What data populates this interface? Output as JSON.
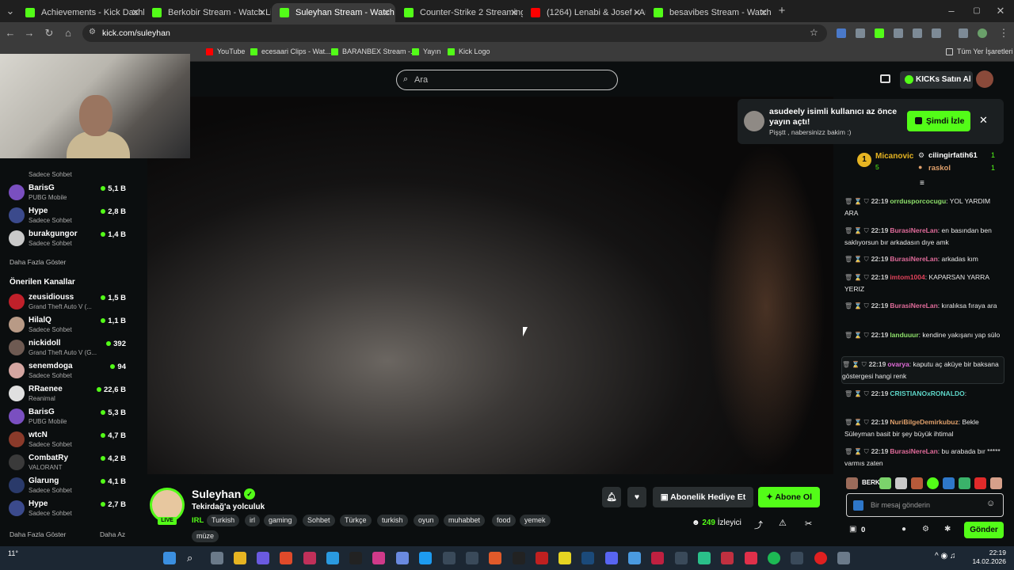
{
  "browser": {
    "tabs": [
      {
        "label": "Achievements - Kick Dashboard",
        "icon": "kick-icon"
      },
      {
        "label": "Berkobir Stream - Watch Live o",
        "icon": "kick-icon"
      },
      {
        "label": "Suleyhan Stream - Watch Li",
        "icon": "kick-icon",
        "active": true
      },
      {
        "label": "Counter-Strike 2 Streaming - Li",
        "icon": "kick-icon"
      },
      {
        "label": "(1264) Lenabi & Josef - Ankara",
        "icon": "youtube-icon"
      },
      {
        "label": "besavibes Stream - Watch Live",
        "icon": "kick-icon"
      }
    ],
    "url": "kick.com/suleyhan",
    "bookmarks": [
      {
        "label": "YouTube",
        "icon": "youtube-icon"
      },
      {
        "label": "ecesaari Clips - Wat...",
        "icon": "kick-icon"
      },
      {
        "label": "BARANBEX Stream -...",
        "icon": "kick-icon"
      },
      {
        "label": "Yayın",
        "icon": "kick-icon"
      },
      {
        "label": "Kick Logo",
        "icon": "kick-icon"
      }
    ],
    "bookmarks_folder": "Tüm Yer İşaretleri"
  },
  "header": {
    "search_placeholder": "Ara",
    "kicks_button": "KICKs Satın Al"
  },
  "sidebar": {
    "top_items": [
      {
        "name": "",
        "category": "Sadece Sohbet",
        "viewers": ""
      },
      {
        "name": "BarisG",
        "category": "PUBG Mobile",
        "viewers": "5,1 B"
      },
      {
        "name": "Hype",
        "category": "Sadece Sohbet",
        "viewers": "2,8 B"
      },
      {
        "name": "burakgungor",
        "category": "Sadece Sohbet",
        "viewers": "1,4 B"
      }
    ],
    "more_1": "Daha Fazla Göster",
    "recommended_heading": "Önerilen Kanallar",
    "recommended": [
      {
        "name": "zeusidiouss",
        "category": "Grand Theft Auto V (...",
        "viewers": "1,5 B"
      },
      {
        "name": "HilalQ",
        "category": "Sadece Sohbet",
        "viewers": "1,1 B"
      },
      {
        "name": "nickidoll",
        "category": "Grand Theft Auto V (G...",
        "viewers": "392"
      },
      {
        "name": "senemdoga",
        "category": "Sadece Sohbet",
        "viewers": "94"
      },
      {
        "name": "RRaenee",
        "category": "Reanimal",
        "viewers": "22,6 B"
      },
      {
        "name": "BarisG",
        "category": "PUBG Mobile",
        "viewers": "5,3 B"
      },
      {
        "name": "wtcN",
        "category": "Sadece Sohbet",
        "viewers": "4,7 B"
      },
      {
        "name": "CombatRy",
        "category": "VALORANT",
        "viewers": "4,2 B"
      },
      {
        "name": "Glarung",
        "category": "Sadece Sohbet",
        "viewers": "4,1 B"
      },
      {
        "name": "Hype",
        "category": "Sadece Sohbet",
        "viewers": "2,7 B"
      }
    ],
    "more_2": "Daha Fazla Göster",
    "less": "Daha Az"
  },
  "toast": {
    "text": "asudeely isimli kullanıcı az önce yayın açtı!",
    "subtext": "Pişştt , nabersinizz bakim :)",
    "button": "Şimdi İzle"
  },
  "pinned": {
    "rank": "1",
    "user1": "Micanovic",
    "user1_count": "5",
    "user2": "cilingirfatih61",
    "user2_count": "1",
    "user3": "raskol",
    "user3_count": "1"
  },
  "chat": {
    "messages": [
      {
        "time": "22:19",
        "user": "orrdusporcocugu",
        "color": "#8ee06b",
        "text": "YOL YARDIM ARA"
      },
      {
        "time": "22:19",
        "user": "BurasiNereLan",
        "color": "#e06b9a",
        "text": "en basından ben saklıyorsun bır arkadasın dıye amk"
      },
      {
        "time": "22:19",
        "user": "BurasiNereLan",
        "color": "#e06b9a",
        "text": "arkadas kım"
      },
      {
        "time": "22:19",
        "user": "imtom1004",
        "color": "#e0425a",
        "text": "KAPARSAN YARRA YERIZ"
      },
      {
        "time": "22:19",
        "user": "BurasiNereLan",
        "color": "#e06b9a",
        "text": "kıralıksa fıraya ara"
      },
      {
        "time": "22:19",
        "user": "landuuur",
        "color": "#8ee06b",
        "text": "kendine yakışanı yap sülo"
      },
      {
        "time": "22:19",
        "user": "ovarya",
        "color": "#e06bd8",
        "text": "kaputu aç aküye bir baksana göstergesi hangi renk"
      },
      {
        "time": "22:19",
        "user": "CRISTIANOxRONALDO",
        "color": "#5ed6c8",
        "text": ""
      },
      {
        "time": "22:19",
        "user": "NuriBilgeDemirkubuz",
        "color": "#e0a06b",
        "text": "Bekle Süleyman basit bir şey büyük ihtimal"
      },
      {
        "time": "22:19",
        "user": "BurasiNereLan",
        "color": "#e06b9a",
        "text": "bu arabada bır ***** varmıs zaten"
      }
    ],
    "emote_text": "BERK",
    "input_placeholder": "Bir mesaj gönderin",
    "send_button": "Gönder",
    "count": "0"
  },
  "stream": {
    "name": "Suleyhan",
    "title": "Tekirdağ'a yolculuk",
    "category": "IRL",
    "tags": [
      "Turkish",
      "irl",
      "gaming",
      "Sohbet",
      "Türkçe",
      "turkish",
      "oyun",
      "muhabbet",
      "food",
      "yemek",
      "müze"
    ],
    "live": "LIVE",
    "gift_button": "Abonelik Hediye Et",
    "sub_button": "Abone Ol",
    "viewers": "249",
    "viewers_label": "İzleyici"
  },
  "taskbar": {
    "weather": "11°",
    "time": "22:19",
    "date": "14.02.2026"
  }
}
